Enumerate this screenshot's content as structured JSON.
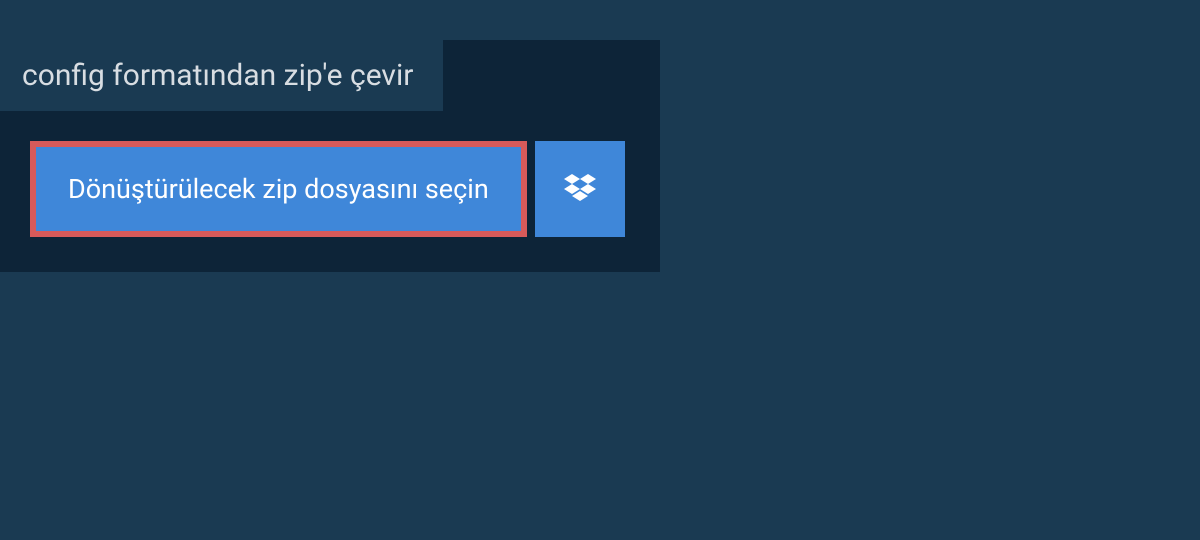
{
  "header": {
    "title": "config formatından zip'e çevir"
  },
  "actions": {
    "select_file_label": "Dönüştürülecek zip dosyasını seçin",
    "dropbox_icon": "dropbox-icon"
  },
  "colors": {
    "background": "#1a3a52",
    "panel": "#0d2438",
    "button": "#3f87d9",
    "highlight_border": "#d75a5a",
    "text_light": "#d8dde2",
    "text_white": "#ffffff"
  }
}
